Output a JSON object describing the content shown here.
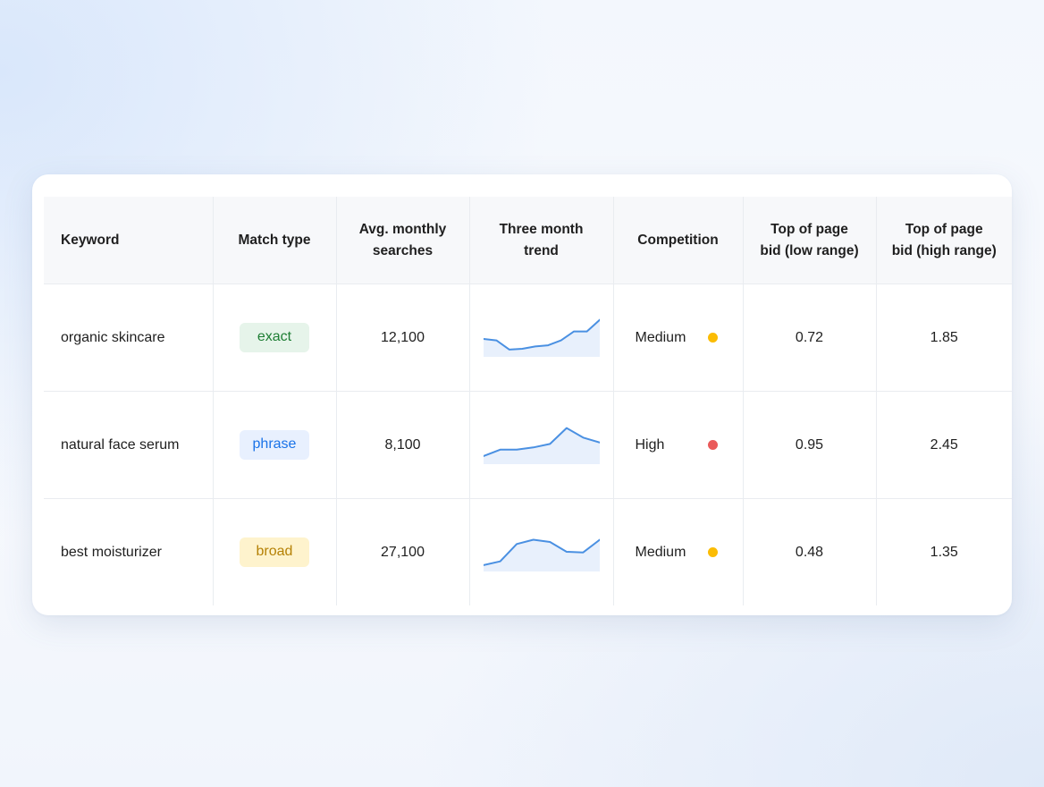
{
  "table": {
    "headers": {
      "keyword": "Keyword",
      "match_type": "Match type",
      "searches": "Avg. monthly\nsearches",
      "trend": "Three month\ntrend",
      "competition": "Competition",
      "bid_low": "Top of page\nbid (low range)",
      "bid_high": "Top of page\nbid (high range)"
    },
    "rows": [
      {
        "keyword": "organic skincare",
        "match_type": "exact",
        "match_style": {
          "bg": "#e6f4ea",
          "color": "#1e7e34"
        },
        "searches": "12,100",
        "trend": [
          0.62,
          0.57,
          0.25,
          0.28,
          0.36,
          0.4,
          0.57,
          0.88,
          0.88,
          1.28
        ],
        "competition": "Medium",
        "competition_color": "#fbbc04",
        "bid_low": "0.72",
        "bid_high": "1.85"
      },
      {
        "keyword": "natural face serum",
        "match_type": "phrase",
        "match_style": {
          "bg": "#e8f0fe",
          "color": "#1a73e8"
        },
        "searches": "8,100",
        "trend": [
          0.28,
          0.5,
          0.5,
          0.58,
          0.7,
          1.25,
          0.92,
          0.75
        ],
        "competition": "High",
        "competition_color": "#ea5a5a",
        "bid_low": "0.95",
        "bid_high": "2.45"
      },
      {
        "keyword": "best moisturizer",
        "match_type": "broad",
        "match_style": {
          "bg": "#fef3cd",
          "color": "#b58105"
        },
        "searches": "27,100",
        "trend": [
          0.22,
          0.35,
          0.95,
          1.1,
          1.02,
          0.68,
          0.66,
          1.1
        ],
        "competition": "Medium",
        "competition_color": "#fbbc04",
        "bid_low": "0.48",
        "bid_high": "1.35"
      }
    ]
  },
  "colors": {
    "trend_line": "#4a90e2",
    "trend_fill": "#e8f0fc"
  }
}
